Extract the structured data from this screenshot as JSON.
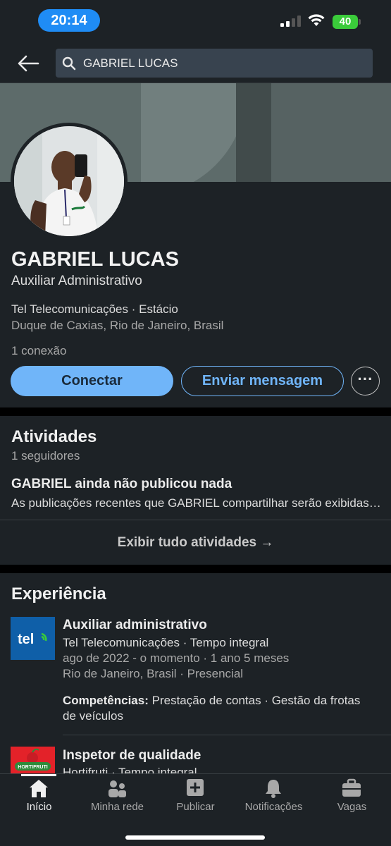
{
  "status_bar": {
    "time": "20:14",
    "battery": "40"
  },
  "search": {
    "value": "GABRIEL LUCAS"
  },
  "profile": {
    "name": "GABRIEL LUCAS",
    "headline": "Auxiliar Administrativo",
    "company_school": "Tel Telecomunicações · Estácio",
    "location": "Duque de Caxias, Rio de Janeiro, Brasil",
    "connections": "1 conexão",
    "connect_label": "Conectar",
    "message_label": "Enviar mensagem",
    "more_label": "···"
  },
  "activity": {
    "title": "Atividades",
    "followers": "1 seguidores",
    "heading": "GABRIEL ainda não publicou nada",
    "description": "As publicações recentes que GABRIEL compartilhar serão exibidas aqui.",
    "show_all": "Exibir tudo atividades →"
  },
  "experience": {
    "title": "Experiência",
    "items": [
      {
        "title": "Auxiliar administrativo",
        "company": "Tel Telecomunicações · Tempo integral",
        "dates": "ago de 2022 - o momento · 1 ano 5 meses",
        "location": "Rio de Janeiro, Brasil · Presencial",
        "skills_label": "Competências:",
        "skills": "Prestação de contas · Gestão da frotas de veículos",
        "logo_text": "tel"
      },
      {
        "title": "Inspetor de qualidade",
        "company": "Hortifruti · Tempo integral",
        "logo_text": "HORTIFRUTI"
      }
    ]
  },
  "bottom_nav": [
    {
      "label": "Início",
      "icon": "home-icon",
      "active": true
    },
    {
      "label": "Minha rede",
      "icon": "network-icon",
      "active": false
    },
    {
      "label": "Publicar",
      "icon": "post-icon",
      "active": false
    },
    {
      "label": "Notificações",
      "icon": "bell-icon",
      "active": false
    },
    {
      "label": "Vagas",
      "icon": "briefcase-icon",
      "active": false
    }
  ],
  "colors": {
    "accent": "#70b5f9",
    "surface": "#1d2226",
    "time_pill": "#1f8cf5",
    "battery": "#3acb3a"
  }
}
